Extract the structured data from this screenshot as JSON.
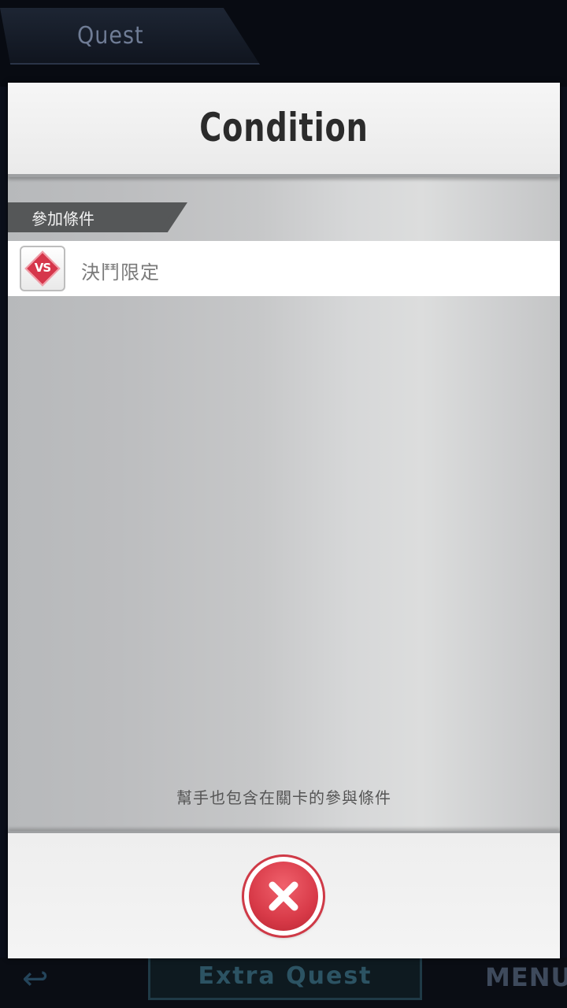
{
  "background": {
    "tab_label": "Quest",
    "extra_quest_label": "Extra Quest",
    "menu_label": "MENU"
  },
  "modal": {
    "title": "Condition",
    "section_label": "參加條件",
    "condition": {
      "icon": "vs-icon",
      "icon_text": "VS",
      "label": "決鬥限定"
    },
    "note": "幫手也包含在關卡的參與條件",
    "close_icon": "close-icon"
  },
  "colors": {
    "accent_red": "#d83a48",
    "section_tag": "#555758"
  }
}
